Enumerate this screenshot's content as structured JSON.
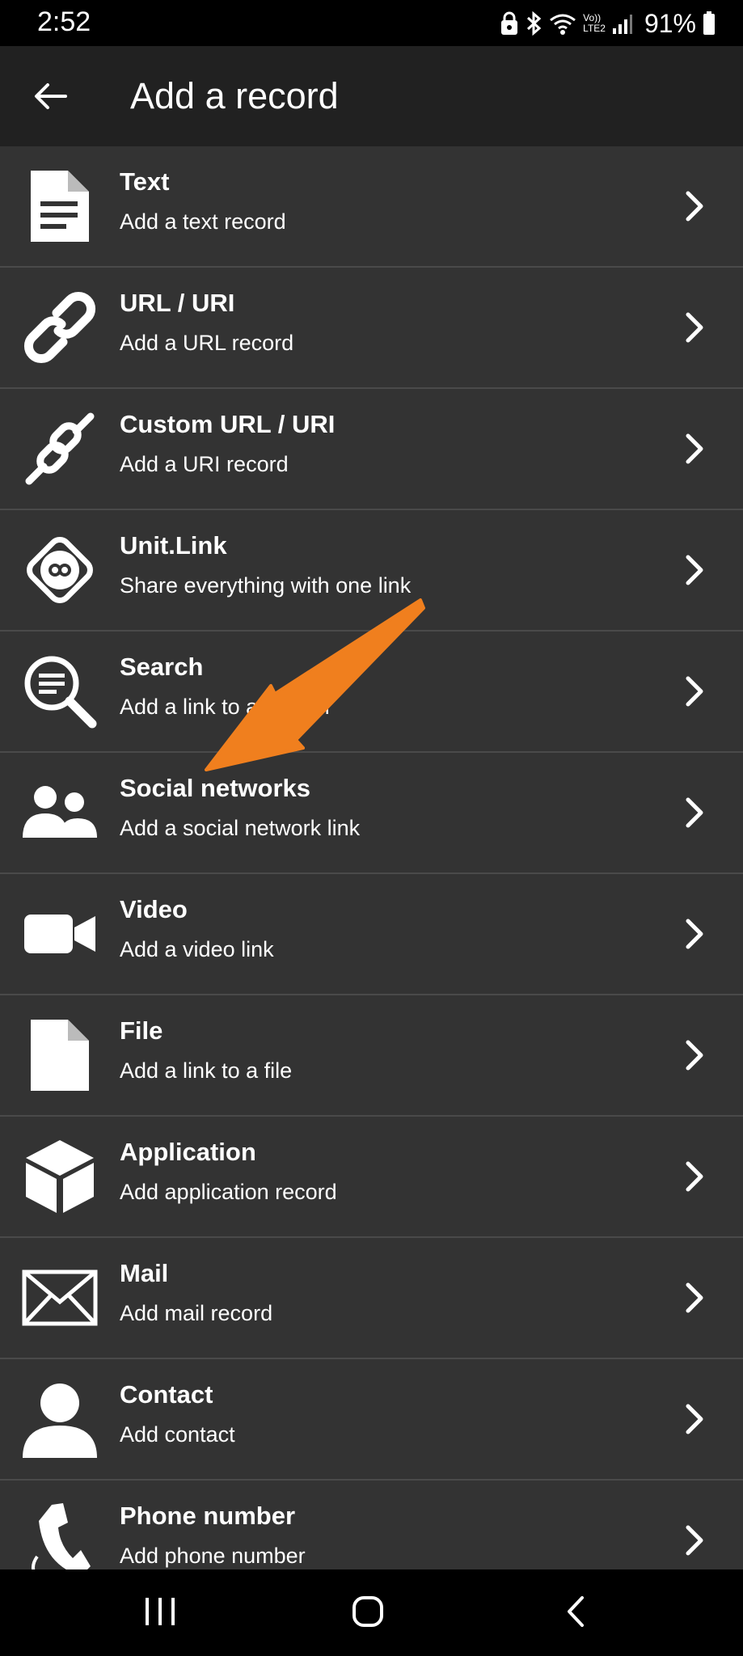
{
  "status": {
    "time": "2:52",
    "battery": "91%",
    "network_label_top": "Vo))",
    "network_label_bottom": "LTE2"
  },
  "app_bar": {
    "title": "Add a record",
    "back_icon": "arrow-left-icon"
  },
  "items": [
    {
      "title": "Text",
      "subtitle": "Add a text record",
      "icon": "document-icon"
    },
    {
      "title": "URL / URI",
      "subtitle": "Add a URL record",
      "icon": "link-icon"
    },
    {
      "title": "Custom URL / URI",
      "subtitle": "Add a URI record",
      "icon": "custom-link-icon"
    },
    {
      "title": "Unit.Link",
      "subtitle": "Share everything with one link",
      "icon": "infinity-icon"
    },
    {
      "title": "Search",
      "subtitle": "Add a link to a search",
      "icon": "search-icon"
    },
    {
      "title": "Social networks",
      "subtitle": "Add a social network link",
      "icon": "people-icon"
    },
    {
      "title": "Video",
      "subtitle": "Add a video link",
      "icon": "video-camera-icon"
    },
    {
      "title": "File",
      "subtitle": "Add a link to a file",
      "icon": "file-icon"
    },
    {
      "title": "Application",
      "subtitle": "Add application record",
      "icon": "cube-icon"
    },
    {
      "title": "Mail",
      "subtitle": "Add mail record",
      "icon": "envelope-icon"
    },
    {
      "title": "Contact",
      "subtitle": "Add contact",
      "icon": "person-icon"
    },
    {
      "title": "Phone number",
      "subtitle": "Add phone number",
      "icon": "phone-icon"
    }
  ],
  "nav_bar": {
    "recents_icon": "recents-icon",
    "home_icon": "home-icon",
    "back_icon": "back-chevron-icon"
  },
  "colors": {
    "background": "#303030",
    "app_bar": "#212121",
    "annotation_arrow": "#f07f1e"
  }
}
